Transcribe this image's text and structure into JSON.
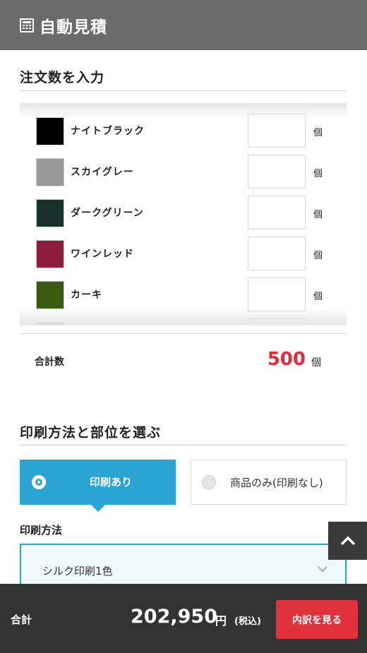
{
  "header": {
    "title": "自動見積",
    "icon": "calculator-icon"
  },
  "order_section": {
    "title": "注文数を入力"
  },
  "colors": [
    {
      "name": "",
      "hex": "#f2f2f2",
      "quantity": ""
    },
    {
      "name": "ナイトブラック",
      "hex": "#000000",
      "quantity": ""
    },
    {
      "name": "スカイグレー",
      "hex": "#9a9a9a",
      "quantity": ""
    },
    {
      "name": "ダークグリーン",
      "hex": "#16322a",
      "quantity": ""
    },
    {
      "name": "ワインレッド",
      "hex": "#8e1b3c",
      "quantity": ""
    },
    {
      "name": "カーキ",
      "hex": "#3a5a0f",
      "quantity": ""
    },
    {
      "name": "",
      "hex": "#5a4a30",
      "quantity": ""
    }
  ],
  "unit": "個",
  "total": {
    "label": "合計数",
    "value": "500",
    "unit": "個"
  },
  "print_section": {
    "title": "印刷方法と部位を選ぶ"
  },
  "options": {
    "with_print": "印刷あり",
    "without_print": "商品のみ(印刷なし)"
  },
  "method": {
    "label": "印刷方法",
    "selected": "シルク印刷1色"
  },
  "footer": {
    "label": "合計",
    "amount": "202,950",
    "yen": "円",
    "tax": "(税込)",
    "button": "内訳を見る"
  },
  "theme": {
    "accent": "#2aa4d2",
    "red": "#e0323c",
    "header_bg": "#6b6b6b",
    "footer_bg": "#333333"
  }
}
